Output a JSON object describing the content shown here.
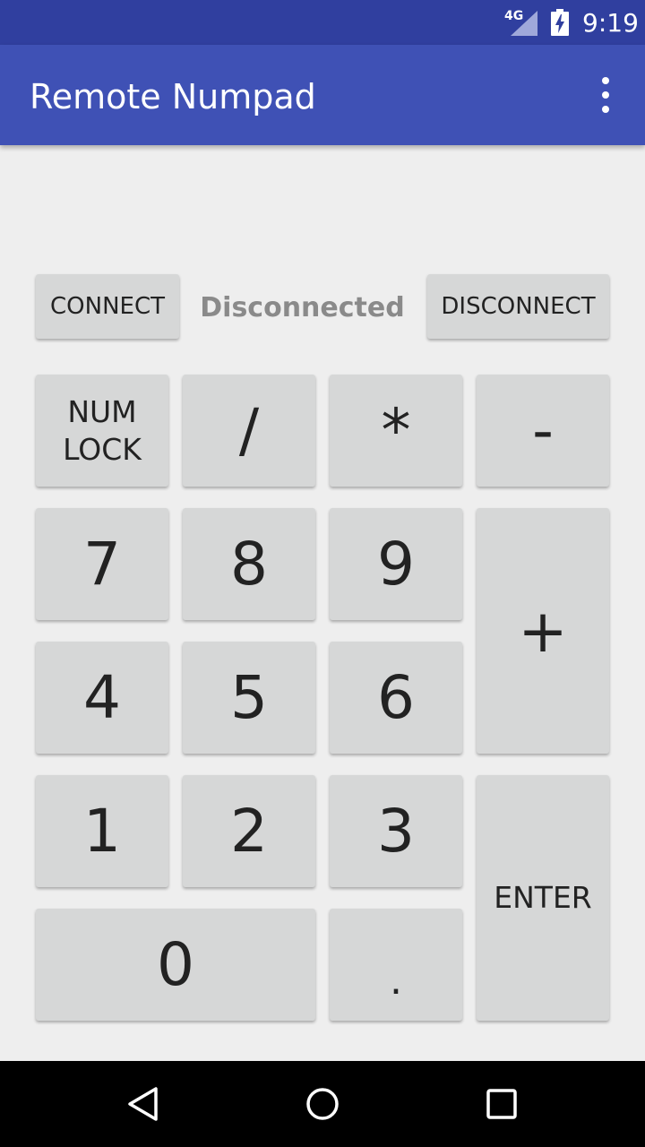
{
  "status_bar": {
    "network": "4G",
    "time": "9:19"
  },
  "app_bar": {
    "title": "Remote Numpad"
  },
  "connection": {
    "connect_label": "CONNECT",
    "status": "Disconnected",
    "disconnect_label": "DISCONNECT"
  },
  "keys": {
    "num_lock": "NUM\nLOCK",
    "divide": "/",
    "multiply": "*",
    "minus": "-",
    "k7": "7",
    "k8": "8",
    "k9": "9",
    "plus": "+",
    "k4": "4",
    "k5": "5",
    "k6": "6",
    "k1": "1",
    "k2": "2",
    "k3": "3",
    "enter": "ENTER",
    "k0": "0",
    "decimal": "."
  },
  "colors": {
    "status_bar": "#303f9f",
    "app_bar": "#3f51b5",
    "button": "#d6d7d7",
    "background": "#eeeeee"
  }
}
